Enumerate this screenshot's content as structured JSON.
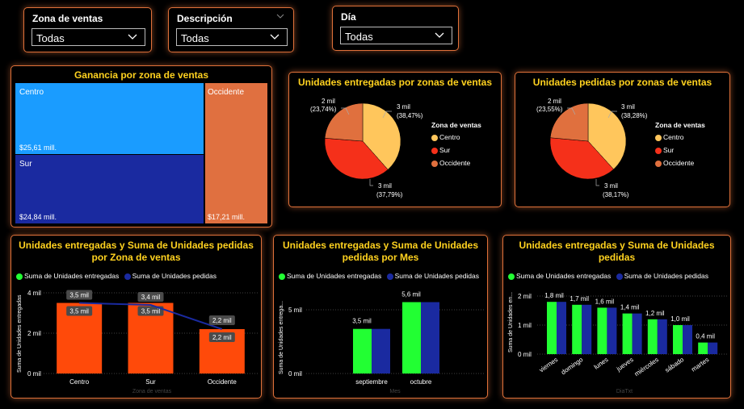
{
  "slicers": [
    {
      "label": "Zona de ventas",
      "value": "Todas"
    },
    {
      "label": "Descripción",
      "value": "Todas"
    },
    {
      "label": "Día",
      "value": "Todas"
    }
  ],
  "treemap": {
    "title": "Ganancia por zona de ventas",
    "tiles": [
      {
        "name": "Centro",
        "value_label": "$25,61 mill.",
        "color": "#1a9cff"
      },
      {
        "name": "Sur",
        "value_label": "$24,84 mill.",
        "color": "#1a2aa0"
      },
      {
        "name": "Occidente",
        "value_label": "$17,21 mill.",
        "color": "#e07040"
      }
    ]
  },
  "pie_entregadas": {
    "title": "Unidades entregadas por zonas de ventas",
    "legend_title": "Zona de ventas",
    "slices": [
      {
        "name": "Centro",
        "pct": 38.47,
        "label1": "3 mil",
        "label2": "(38,47%)",
        "color": "#ffc65c"
      },
      {
        "name": "Sur",
        "pct": 37.79,
        "label1": "3 mil",
        "label2": "(37,79%)",
        "color": "#f5301a"
      },
      {
        "name": "Occidente",
        "pct": 23.74,
        "label1": "2 mil",
        "label2": "(23,74%)",
        "color": "#e0703e"
      }
    ]
  },
  "pie_pedidas": {
    "title": "Unidades pedidas por zonas de ventas",
    "legend_title": "Zona de ventas",
    "slices": [
      {
        "name": "Centro",
        "pct": 38.28,
        "label1": "3 mil",
        "label2": "(38,28%)",
        "color": "#ffc65c"
      },
      {
        "name": "Sur",
        "pct": 38.17,
        "label1": "3 mil",
        "label2": "(38,17%)",
        "color": "#f5301a"
      },
      {
        "name": "Occidente",
        "pct": 23.55,
        "label1": "2 mil",
        "label2": "(23,55%)",
        "color": "#e0703e"
      }
    ]
  },
  "combo_zona": {
    "title1": "Unidades entregadas y Suma de Unidades pedidas",
    "title2": "por Zona de ventas",
    "legend": [
      "Suma de Unidades entregadas",
      "Suma de Unidades pedidas"
    ],
    "ylabel": "Suma de Unidades entregadas",
    "xlabel": "Zona de ventas",
    "ticks": [
      "4 mil",
      "2 mil",
      "0 mil"
    ],
    "categories": [
      "Centro",
      "Sur",
      "Occidente"
    ],
    "bar_labels": [
      "3,5 mil",
      "3,5 mil",
      "2,2 mil"
    ],
    "line_labels": [
      "3,5 mil",
      "3,4 mil",
      "2,2 mil"
    ]
  },
  "bar_mes": {
    "title1": "Unidades entregadas y Suma de Unidades",
    "title2": "pedidas por Mes",
    "legend": [
      "Suma de Unidades entregadas",
      "Suma de Unidades pedidas"
    ],
    "ylabel": "Suma de Unidades entrega...",
    "xlabel": "Mes",
    "ticks": [
      "5 mil",
      "0 mil"
    ],
    "categories": [
      "septiembre",
      "octubre"
    ],
    "labels": [
      "3,5 mil",
      "5,6 mil"
    ]
  },
  "bar_dia": {
    "title1": "Unidades entregadas y Suma de Unidades",
    "title2": "pedidas",
    "legend": [
      "Suma de Unidades entregadas",
      "Suma de Unidades pedidas"
    ],
    "ylabel": "Suma de Unidades en...",
    "xlabel": "DiaTxt",
    "ticks": [
      "2 mil",
      "1 mil",
      "0 mil"
    ],
    "categories": [
      "viernes",
      "domingo",
      "lunes",
      "jueves",
      "miércoles",
      "sábado",
      "martes"
    ],
    "labels": [
      "1,8 mil",
      "1,7 mil",
      "1,6 mil",
      "1,4 mil",
      "1,2 mil",
      "1,0 mil",
      "0,4 mil"
    ]
  },
  "colors": {
    "accent_border": "#e0713a",
    "title_yellow": "#ffd21f",
    "green": "#22ff33",
    "navy": "#1a2aa0",
    "orange_bar": "#ff4a0a"
  },
  "chart_data": [
    {
      "type": "bar",
      "title": "Unidades entregadas y Suma de Unidades pedidas por Zona de ventas",
      "categories": [
        "Centro",
        "Sur",
        "Occidente"
      ],
      "xlabel": "Zona de ventas",
      "ylabel": "Suma de Unidades entregadas",
      "ylim": [
        0,
        4000
      ],
      "series": [
        {
          "name": "Suma de Unidades entregadas",
          "kind": "bar",
          "values": [
            3500,
            3500,
            2200
          ]
        },
        {
          "name": "Suma de Unidades pedidas",
          "kind": "line",
          "values": [
            3500,
            3400,
            2200
          ]
        }
      ]
    },
    {
      "type": "bar",
      "title": "Unidades entregadas y Suma de Unidades pedidas por Mes",
      "categories": [
        "septiembre",
        "octubre"
      ],
      "xlabel": "Mes",
      "ylim": [
        0,
        7000
      ],
      "series": [
        {
          "name": "Suma de Unidades entregadas",
          "values": [
            3500,
            5600
          ]
        },
        {
          "name": "Suma de Unidades pedidas",
          "values": [
            3500,
            5600
          ]
        }
      ]
    },
    {
      "type": "bar",
      "title": "Unidades entregadas y Suma de Unidades pedidas",
      "categories": [
        "viernes",
        "domingo",
        "lunes",
        "jueves",
        "miércoles",
        "sábado",
        "martes"
      ],
      "xlabel": "DiaTxt",
      "ylim": [
        0,
        2300
      ],
      "series": [
        {
          "name": "Suma de Unidades entregadas",
          "values": [
            1800,
            1700,
            1600,
            1400,
            1200,
            1000,
            400
          ]
        },
        {
          "name": "Suma de Unidades pedidas",
          "values": [
            1800,
            1700,
            1600,
            1400,
            1200,
            1000,
            400
          ]
        }
      ]
    },
    {
      "type": "pie",
      "title": "Unidades entregadas por zonas de ventas",
      "categories": [
        "Centro",
        "Sur",
        "Occidente"
      ],
      "values": [
        38.47,
        37.79,
        23.74
      ]
    },
    {
      "type": "pie",
      "title": "Unidades pedidas por zonas de ventas",
      "categories": [
        "Centro",
        "Sur",
        "Occidente"
      ],
      "values": [
        38.28,
        38.17,
        23.55
      ]
    }
  ]
}
